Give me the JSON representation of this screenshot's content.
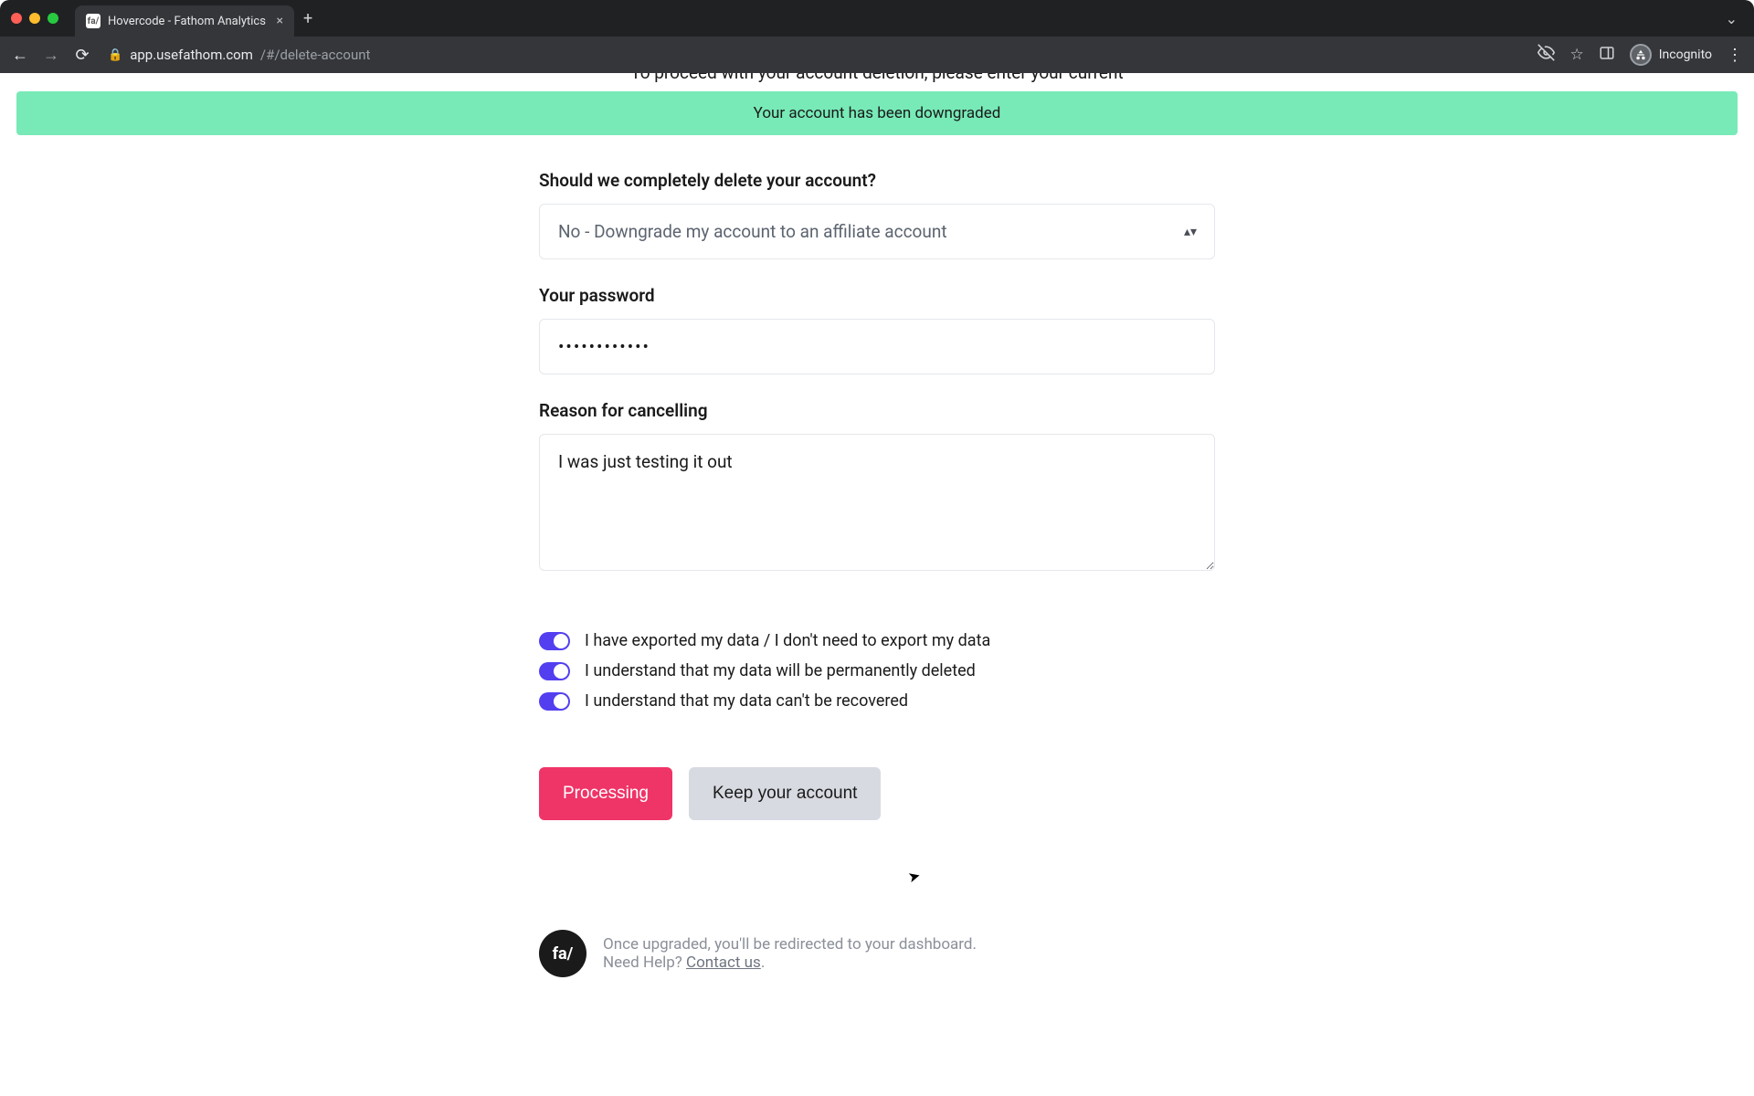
{
  "browser": {
    "tab_title": "Hovercode - Fathom Analytics",
    "favicon_text": "fa/",
    "url_host": "app.usefathom.com",
    "url_path": "/#/delete-account",
    "incognito_label": "Incognito"
  },
  "page": {
    "peek_text": "To proceed with your account deletion, please enter your current",
    "flash_message": "Your account has been downgraded"
  },
  "form": {
    "delete_question_label": "Should we completely delete your account?",
    "delete_select_value": "No - Downgrade my account to an affiliate account",
    "password_label": "Your password",
    "password_value": "••••••••••••",
    "reason_label": "Reason for cancelling",
    "reason_value": "I was just testing it out"
  },
  "toggles": [
    {
      "label": "I have exported my data / I don't need to export my data"
    },
    {
      "label": "I understand that my data will be permanently deleted"
    },
    {
      "label": "I understand that my data can't be recovered"
    }
  ],
  "buttons": {
    "primary": "Processing",
    "secondary": "Keep your account"
  },
  "footer": {
    "logo_text": "fa/",
    "line1": "Once upgraded, you'll be redirected to your dashboard.",
    "line2_prefix": "Need Help? ",
    "line2_link": "Contact us",
    "line2_suffix": "."
  }
}
